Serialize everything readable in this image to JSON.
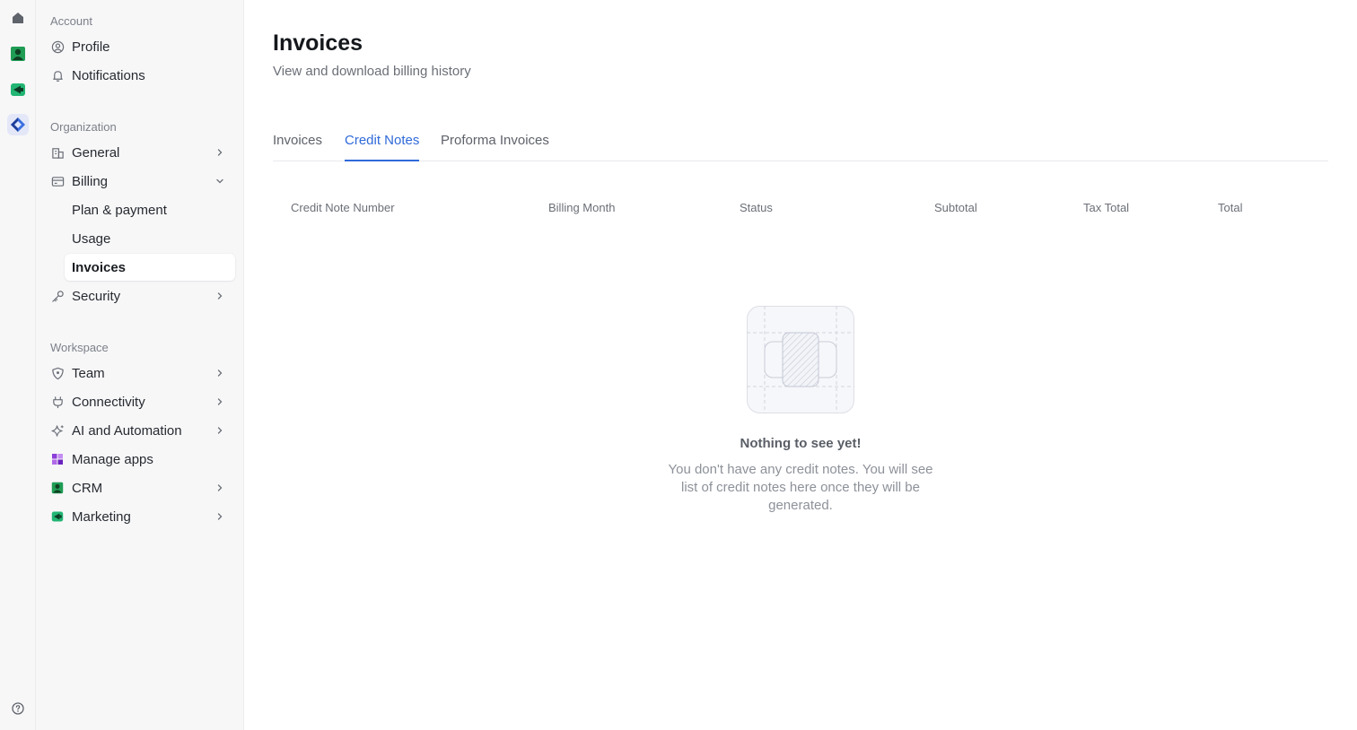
{
  "sidebar": {
    "sections": [
      {
        "label": "Account"
      },
      {
        "label": "Organization"
      },
      {
        "label": "Workspace"
      }
    ],
    "account_items": [
      {
        "label": "Profile",
        "icon": "user-circle-icon"
      },
      {
        "label": "Notifications",
        "icon": "bell-icon"
      }
    ],
    "org_items": [
      {
        "label": "General",
        "icon": "building-icon"
      },
      {
        "label": "Billing",
        "icon": "credit-card-icon"
      },
      {
        "label": "Security",
        "icon": "key-icon"
      }
    ],
    "billing_sub": [
      {
        "label": "Plan & payment"
      },
      {
        "label": "Usage"
      },
      {
        "label": "Invoices"
      }
    ],
    "workspace_items": [
      {
        "label": "Team",
        "icon": "shield-icon"
      },
      {
        "label": "Connectivity",
        "icon": "plug-icon"
      },
      {
        "label": "AI and Automation",
        "icon": "sparkle-icon"
      },
      {
        "label": "Manage apps",
        "icon": "apps-grid-icon"
      },
      {
        "label": "CRM",
        "icon": "crm-app-icon"
      },
      {
        "label": "Marketing",
        "icon": "marketing-app-icon"
      }
    ]
  },
  "header": {
    "title": "Invoices",
    "subtitle": "View and download billing history"
  },
  "tabs": [
    {
      "label": "Invoices"
    },
    {
      "label": "Credit Notes"
    },
    {
      "label": "Proforma Invoices"
    }
  ],
  "active_tab": "Credit Notes",
  "table": {
    "columns": [
      "Credit Note Number",
      "Billing Month",
      "Status",
      "Subtotal",
      "Tax Total",
      "Total"
    ]
  },
  "empty_state": {
    "title": "Nothing to see yet!",
    "description": "You don't have any credit notes. You will see list of credit notes here once they will be generated."
  },
  "colors": {
    "accent": "#2f6ad9",
    "crm_green": "#1f9d55",
    "marketing_green": "#22b573",
    "manage_apps_purple": "#8b3fd9"
  }
}
